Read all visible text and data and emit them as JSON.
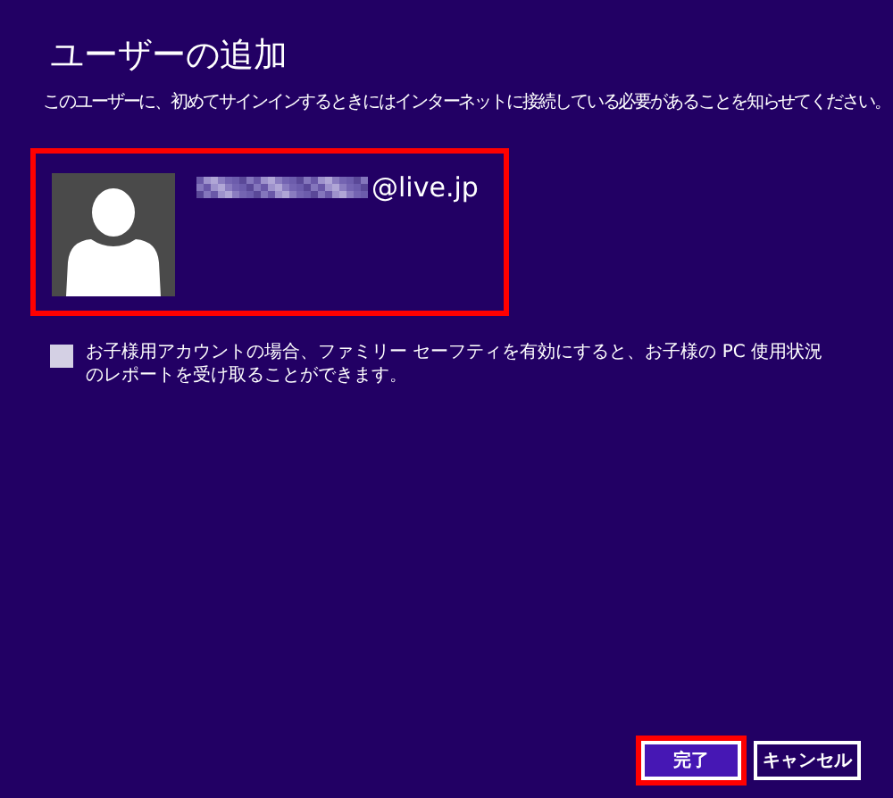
{
  "title": "ユーザーの追加",
  "description": "このユーザーに、初めてサインインするときにはインターネットに接続している必要があることを知らせてください。",
  "account": {
    "email_visible": "@live.jp",
    "email_pixelated": true,
    "highlighted": true
  },
  "family_safety": {
    "label": "お子様用アカウントの場合、ファミリー セーフティを有効にすると、お子様の PC 使用状況のレポートを受け取ることができます。",
    "checked": false
  },
  "buttons": [
    {
      "label": "完了",
      "kind": "primary",
      "highlighted": true
    },
    {
      "label": "キャンセル",
      "kind": "secondary",
      "highlighted": false
    }
  ]
}
